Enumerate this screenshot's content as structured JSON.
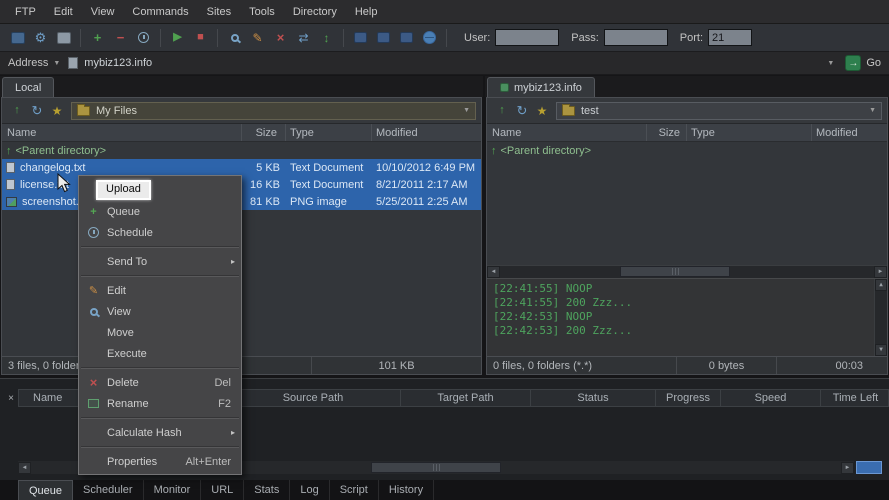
{
  "menubar": {
    "items": [
      "FTP",
      "Edit",
      "View",
      "Commands",
      "Sites",
      "Tools",
      "Directory",
      "Help"
    ]
  },
  "toolbar": {
    "user_label": "User:",
    "pass_label": "Pass:",
    "port_label": "Port:",
    "port_value": "21"
  },
  "addressbar": {
    "label": "Address",
    "value": "mybiz123.info",
    "go_label": "Go"
  },
  "local_pane": {
    "tab": "Local",
    "path": "My Files",
    "columns": [
      "Name",
      "Size",
      "Type",
      "Modified"
    ],
    "parent_row": "<Parent directory>",
    "files": [
      {
        "name": "changelog.txt",
        "size": "5 KB",
        "type": "Text Document",
        "modified": "10/10/2012 6:49 PM"
      },
      {
        "name": "license.txt",
        "size": "16 KB",
        "type": "Text Document",
        "modified": "8/21/2011 2:17 AM"
      },
      {
        "name": "screenshot.png",
        "size": "81 KB",
        "type": "PNG image",
        "modified": "5/25/2011 2:25 AM"
      }
    ],
    "status_files": "3 files, 0 folders",
    "status_size": "101 KB"
  },
  "remote_pane": {
    "tab": "mybiz123.info",
    "path": "test",
    "columns": [
      "Name",
      "Size",
      "Type",
      "Modified"
    ],
    "parent_row": "<Parent directory>",
    "log_lines": [
      "[22:41:55] NOOP",
      "[22:41:55] 200 Zzz...",
      "[22:42:53] NOOP",
      "[22:42:53] 200 Zzz..."
    ],
    "status_files": "0 files, 0 folders (*.*)",
    "status_size": "0 bytes",
    "status_time": "00:03"
  },
  "queue_panel": {
    "columns": [
      "Name",
      "Source Path",
      "Target Path",
      "Status",
      "Progress",
      "Speed",
      "Time Left"
    ],
    "tabs": [
      "Queue",
      "Scheduler",
      "Monitor",
      "URL",
      "Stats",
      "Log",
      "Script",
      "History"
    ]
  },
  "context_menu": {
    "items": [
      {
        "label": "Upload"
      },
      {
        "label": "Queue"
      },
      {
        "label": "Schedule"
      },
      {
        "label": "Send To"
      },
      {
        "label": "Edit"
      },
      {
        "label": "View"
      },
      {
        "label": "Move"
      },
      {
        "label": "Execute"
      },
      {
        "label": "Delete",
        "shortcut": "Del"
      },
      {
        "label": "Rename",
        "shortcut": "F2"
      },
      {
        "label": "Calculate Hash"
      },
      {
        "label": "Properties",
        "shortcut": "Alt+Enter"
      }
    ]
  },
  "icons": {
    "dropdown": "▼",
    "plus": "+",
    "minus": "−",
    "play": "▶",
    "stop": "■",
    "gear": "⚙",
    "pencil": "✎",
    "cross": "×",
    "refresh": "↻",
    "star": "★",
    "up_arrow": "↑",
    "swap": "⇄",
    "updown": "↕",
    "left_arrow": "◄",
    "right_arrow": "►",
    "up_small": "▲",
    "down_small": "▼",
    "submenu": "▸",
    "close": "×",
    "go_arrow": "→"
  }
}
